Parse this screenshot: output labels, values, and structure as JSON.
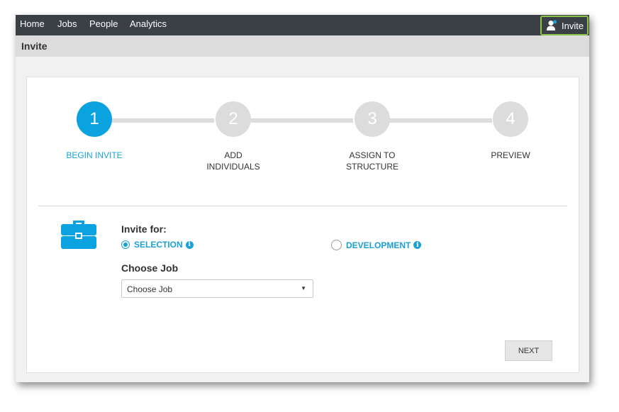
{
  "nav": {
    "items": [
      {
        "label": "Home"
      },
      {
        "label": "Jobs"
      },
      {
        "label": "People"
      },
      {
        "label": "Analytics"
      }
    ],
    "invite_button": {
      "label": "Invite",
      "icon": "add-user-icon",
      "border_color": "#8bc34a"
    }
  },
  "page": {
    "title": "Invite"
  },
  "wizard": {
    "steps": [
      {
        "number": "1",
        "label_line1": "BEGIN INVITE",
        "label_line2": "",
        "active": true
      },
      {
        "number": "2",
        "label_line1": "ADD",
        "label_line2": "INDIVIDUALS",
        "active": false
      },
      {
        "number": "3",
        "label_line1": "ASSIGN TO",
        "label_line2": "STRUCTURE",
        "active": false
      },
      {
        "number": "4",
        "label_line1": "PREVIEW",
        "label_line2": "",
        "active": false
      }
    ],
    "accent_color": "#0aa3e0",
    "inactive_color": "#dcdcdc"
  },
  "form": {
    "section_icon": "briefcase-icon",
    "invite_for_label": "Invite for:",
    "options": [
      {
        "label": "SELECTION",
        "selected": true,
        "info_icon": "info-icon"
      },
      {
        "label": "DEVELOPMENT",
        "selected": false,
        "info_icon": "info-icon"
      }
    ],
    "choose_job_heading": "Choose Job",
    "job_select": {
      "value": "Choose Job"
    },
    "next_label": "NEXT"
  }
}
